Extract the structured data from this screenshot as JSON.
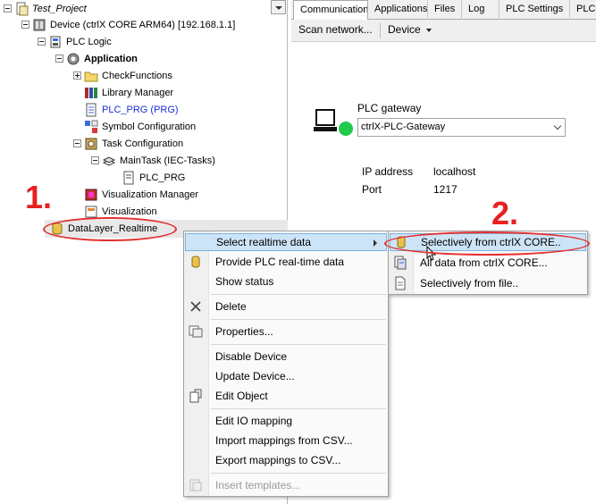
{
  "tree": {
    "items": [
      {
        "label": "Test_Project",
        "icon": "project-icon",
        "style": "italic"
      },
      {
        "label": "Device (ctrlX CORE ARM64) [192.168.1.1]",
        "icon": "device-icon"
      },
      {
        "label": "PLC Logic",
        "icon": "plc-logic-icon"
      },
      {
        "label": "Application",
        "icon": "application-gear-icon",
        "style": "bold"
      },
      {
        "label": "CheckFunctions",
        "icon": "folder-icon"
      },
      {
        "label": "Library Manager",
        "icon": "library-books-icon"
      },
      {
        "label": "PLC_PRG (PRG)",
        "icon": "program-document-icon",
        "color": "#1a2fd6"
      },
      {
        "label": "Symbol Configuration",
        "icon": "symbol-config-icon"
      },
      {
        "label": "Task Configuration",
        "icon": "task-config-icon"
      },
      {
        "label": "MainTask (IEC-Tasks)",
        "icon": "task-stack-icon"
      },
      {
        "label": "PLC_PRG",
        "icon": "program-call-icon"
      },
      {
        "label": "Visualization Manager",
        "icon": "visualization-manager-icon"
      },
      {
        "label": "Visualization",
        "icon": "visualization-icon"
      },
      {
        "label": "DataLayer_Realtime",
        "icon": "datalayer-cylinder-icon"
      }
    ]
  },
  "tabs": [
    "Communication",
    "Applications",
    "Files",
    "Log",
    "PLC Settings",
    "PLC S"
  ],
  "toolbar": {
    "scan_label": "Scan network...",
    "device_label": "Device"
  },
  "gateway": {
    "title": "PLC gateway",
    "selected": "ctrlX-PLC-Gateway",
    "status_color": "#22c94a",
    "ip_label": "IP address",
    "ip_value": "localhost",
    "port_label": "Port",
    "port_value": "1217"
  },
  "context_menu": {
    "items": [
      {
        "label": "Select realtime data",
        "submenu": true,
        "selected": true
      },
      {
        "label": "Provide PLC real-time data",
        "icon": "datalayer-cylinder-icon"
      },
      {
        "label": "Show status"
      },
      {
        "label": "Delete",
        "icon": "delete-x-icon"
      },
      {
        "label": "Properties...",
        "icon": "properties-icon"
      },
      {
        "label": "Disable Device"
      },
      {
        "label": "Update Device..."
      },
      {
        "label": "Edit Object",
        "icon": "edit-object-icon"
      },
      {
        "label": "Edit IO mapping"
      },
      {
        "label": "Import mappings from CSV..."
      },
      {
        "label": "Export mappings to CSV..."
      },
      {
        "label": "Insert templates...",
        "disabled": true,
        "icon": "insert-templates-icon"
      }
    ]
  },
  "submenu": {
    "items": [
      {
        "label": "Selectively from ctrlX CORE..",
        "icon": "datalayer-cylinder-icon",
        "selected": true
      },
      {
        "label": "All data from ctrlX CORE...",
        "icon": "all-data-icon"
      },
      {
        "label": "Selectively from file..",
        "icon": "file-icon"
      }
    ]
  },
  "annotations": {
    "step1": "1.",
    "step2": "2.",
    "color": "#e53030"
  }
}
